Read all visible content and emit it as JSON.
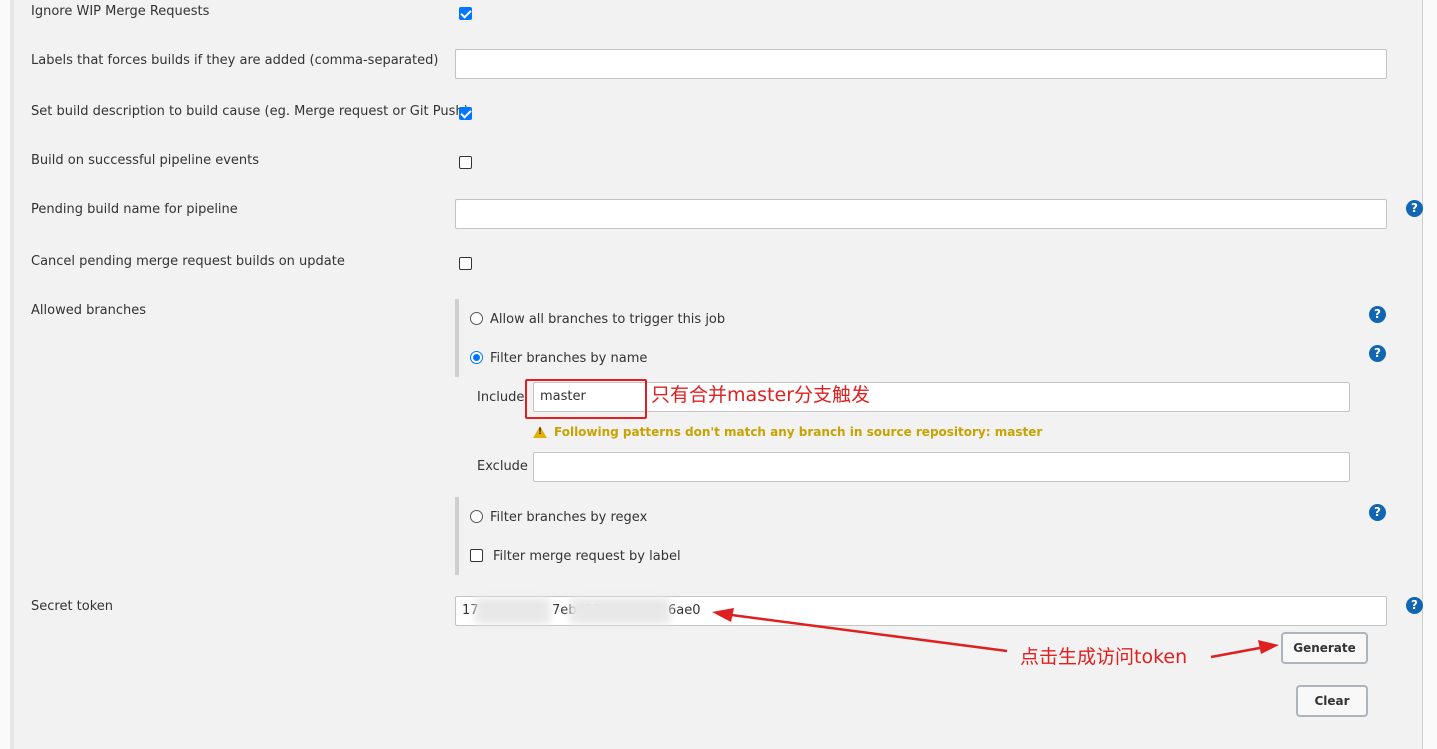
{
  "form": {
    "ignore_wip": {
      "label": "Ignore WIP Merge Requests",
      "checked": true
    },
    "labels_force": {
      "label": "Labels that forces builds if they are added (comma-separated)",
      "value": ""
    },
    "set_description": {
      "label": "Set build description to build cause (eg. Merge request or Git Push)",
      "checked": true
    },
    "build_pipeline": {
      "label": "Build on successful pipeline events",
      "checked": false
    },
    "pending_name": {
      "label": "Pending build name for pipeline",
      "value": ""
    },
    "cancel_pending": {
      "label": "Cancel pending merge request builds on update",
      "checked": false
    },
    "allowed_branches": {
      "label": "Allowed branches",
      "allow_all": "Allow all branches to trigger this job",
      "filter_name": "Filter branches by name",
      "include_label": "Include",
      "include_value": "master",
      "warning": "Following patterns don't match any branch in source repository: master",
      "exclude_label": "Exclude",
      "exclude_value": "",
      "filter_regex": "Filter branches by regex",
      "filter_label": "Filter merge request by label",
      "selected": "filter_name"
    },
    "secret_token": {
      "label": "Secret token",
      "value_part1": "17",
      "value_part2": "7ebe30",
      "value_part3": "6ae0"
    },
    "generate_label": "Generate",
    "clear_label": "Clear"
  },
  "annotations": {
    "include_note": "只有合并master分支触发",
    "token_note": "点击生成访问token"
  },
  "colors": {
    "accent": "#0075ff",
    "help": "#1066b3",
    "annotation": "#e02020",
    "warning": "#c8a200"
  }
}
